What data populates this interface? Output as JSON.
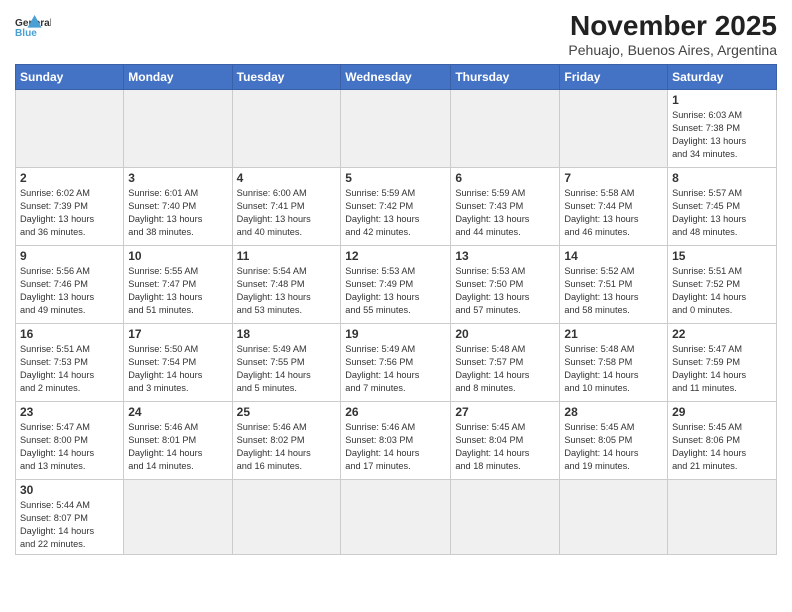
{
  "header": {
    "logo_general": "General",
    "logo_blue": "Blue",
    "month": "November 2025",
    "location": "Pehuajo, Buenos Aires, Argentina"
  },
  "weekdays": [
    "Sunday",
    "Monday",
    "Tuesday",
    "Wednesday",
    "Thursday",
    "Friday",
    "Saturday"
  ],
  "weeks": [
    [
      {
        "day": "",
        "info": ""
      },
      {
        "day": "",
        "info": ""
      },
      {
        "day": "",
        "info": ""
      },
      {
        "day": "",
        "info": ""
      },
      {
        "day": "",
        "info": ""
      },
      {
        "day": "",
        "info": ""
      },
      {
        "day": "1",
        "info": "Sunrise: 6:03 AM\nSunset: 7:38 PM\nDaylight: 13 hours\nand 34 minutes."
      }
    ],
    [
      {
        "day": "2",
        "info": "Sunrise: 6:02 AM\nSunset: 7:39 PM\nDaylight: 13 hours\nand 36 minutes."
      },
      {
        "day": "3",
        "info": "Sunrise: 6:01 AM\nSunset: 7:40 PM\nDaylight: 13 hours\nand 38 minutes."
      },
      {
        "day": "4",
        "info": "Sunrise: 6:00 AM\nSunset: 7:41 PM\nDaylight: 13 hours\nand 40 minutes."
      },
      {
        "day": "5",
        "info": "Sunrise: 5:59 AM\nSunset: 7:42 PM\nDaylight: 13 hours\nand 42 minutes."
      },
      {
        "day": "6",
        "info": "Sunrise: 5:59 AM\nSunset: 7:43 PM\nDaylight: 13 hours\nand 44 minutes."
      },
      {
        "day": "7",
        "info": "Sunrise: 5:58 AM\nSunset: 7:44 PM\nDaylight: 13 hours\nand 46 minutes."
      },
      {
        "day": "8",
        "info": "Sunrise: 5:57 AM\nSunset: 7:45 PM\nDaylight: 13 hours\nand 48 minutes."
      }
    ],
    [
      {
        "day": "9",
        "info": "Sunrise: 5:56 AM\nSunset: 7:46 PM\nDaylight: 13 hours\nand 49 minutes."
      },
      {
        "day": "10",
        "info": "Sunrise: 5:55 AM\nSunset: 7:47 PM\nDaylight: 13 hours\nand 51 minutes."
      },
      {
        "day": "11",
        "info": "Sunrise: 5:54 AM\nSunset: 7:48 PM\nDaylight: 13 hours\nand 53 minutes."
      },
      {
        "day": "12",
        "info": "Sunrise: 5:53 AM\nSunset: 7:49 PM\nDaylight: 13 hours\nand 55 minutes."
      },
      {
        "day": "13",
        "info": "Sunrise: 5:53 AM\nSunset: 7:50 PM\nDaylight: 13 hours\nand 57 minutes."
      },
      {
        "day": "14",
        "info": "Sunrise: 5:52 AM\nSunset: 7:51 PM\nDaylight: 13 hours\nand 58 minutes."
      },
      {
        "day": "15",
        "info": "Sunrise: 5:51 AM\nSunset: 7:52 PM\nDaylight: 14 hours\nand 0 minutes."
      }
    ],
    [
      {
        "day": "16",
        "info": "Sunrise: 5:51 AM\nSunset: 7:53 PM\nDaylight: 14 hours\nand 2 minutes."
      },
      {
        "day": "17",
        "info": "Sunrise: 5:50 AM\nSunset: 7:54 PM\nDaylight: 14 hours\nand 3 minutes."
      },
      {
        "day": "18",
        "info": "Sunrise: 5:49 AM\nSunset: 7:55 PM\nDaylight: 14 hours\nand 5 minutes."
      },
      {
        "day": "19",
        "info": "Sunrise: 5:49 AM\nSunset: 7:56 PM\nDaylight: 14 hours\nand 7 minutes."
      },
      {
        "day": "20",
        "info": "Sunrise: 5:48 AM\nSunset: 7:57 PM\nDaylight: 14 hours\nand 8 minutes."
      },
      {
        "day": "21",
        "info": "Sunrise: 5:48 AM\nSunset: 7:58 PM\nDaylight: 14 hours\nand 10 minutes."
      },
      {
        "day": "22",
        "info": "Sunrise: 5:47 AM\nSunset: 7:59 PM\nDaylight: 14 hours\nand 11 minutes."
      }
    ],
    [
      {
        "day": "23",
        "info": "Sunrise: 5:47 AM\nSunset: 8:00 PM\nDaylight: 14 hours\nand 13 minutes."
      },
      {
        "day": "24",
        "info": "Sunrise: 5:46 AM\nSunset: 8:01 PM\nDaylight: 14 hours\nand 14 minutes."
      },
      {
        "day": "25",
        "info": "Sunrise: 5:46 AM\nSunset: 8:02 PM\nDaylight: 14 hours\nand 16 minutes."
      },
      {
        "day": "26",
        "info": "Sunrise: 5:46 AM\nSunset: 8:03 PM\nDaylight: 14 hours\nand 17 minutes."
      },
      {
        "day": "27",
        "info": "Sunrise: 5:45 AM\nSunset: 8:04 PM\nDaylight: 14 hours\nand 18 minutes."
      },
      {
        "day": "28",
        "info": "Sunrise: 5:45 AM\nSunset: 8:05 PM\nDaylight: 14 hours\nand 19 minutes."
      },
      {
        "day": "29",
        "info": "Sunrise: 5:45 AM\nSunset: 8:06 PM\nDaylight: 14 hours\nand 21 minutes."
      }
    ],
    [
      {
        "day": "30",
        "info": "Sunrise: 5:44 AM\nSunset: 8:07 PM\nDaylight: 14 hours\nand 22 minutes."
      },
      {
        "day": "",
        "info": ""
      },
      {
        "day": "",
        "info": ""
      },
      {
        "day": "",
        "info": ""
      },
      {
        "day": "",
        "info": ""
      },
      {
        "day": "",
        "info": ""
      },
      {
        "day": "",
        "info": ""
      }
    ]
  ]
}
